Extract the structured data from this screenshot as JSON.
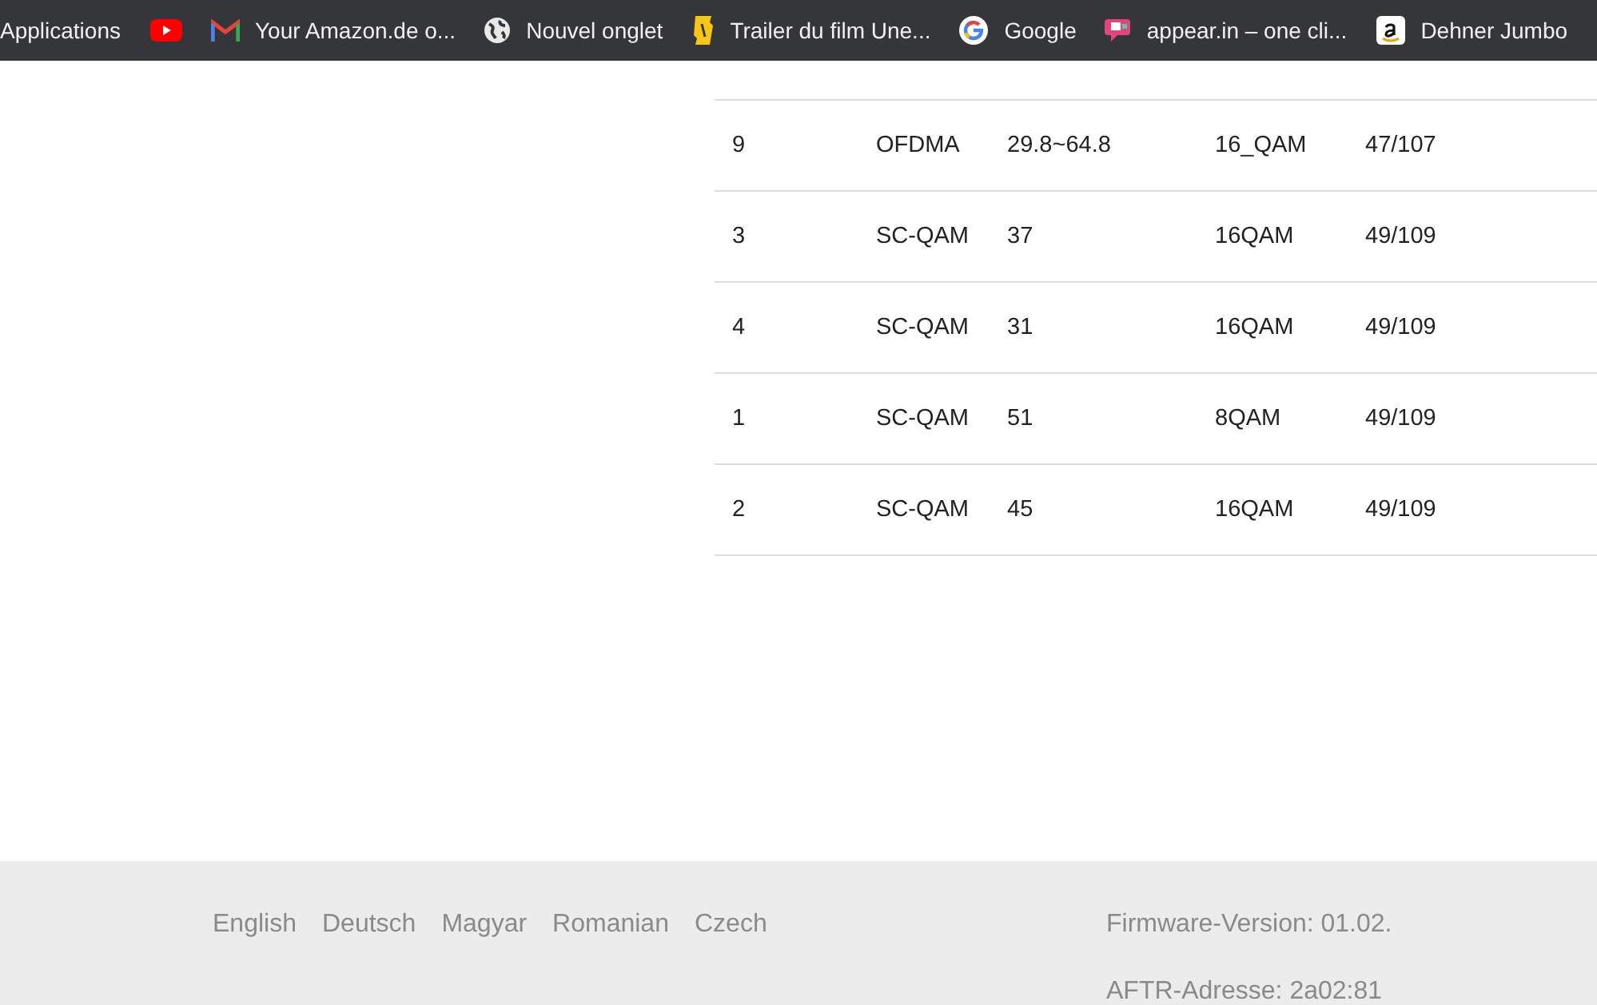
{
  "bookmarks": [
    {
      "kind": "text",
      "label": "Applications"
    },
    {
      "kind": "youtube"
    },
    {
      "kind": "gmail",
      "label": "Your Amazon.de o..."
    },
    {
      "kind": "globe",
      "label": "Nouvel onglet"
    },
    {
      "kind": "ticket",
      "label": "Trailer du film Une..."
    },
    {
      "kind": "google",
      "label": "Google"
    },
    {
      "kind": "chat",
      "label": "appear.in – one cli..."
    },
    {
      "kind": "amazon",
      "label": "Dehner Jumbo"
    }
  ],
  "table": {
    "rows": [
      [
        "9",
        "OFDMA",
        "29.8~64.8",
        "16_QAM",
        "47/107"
      ],
      [
        "3",
        "SC-QAM",
        "37",
        "16QAM",
        "49/109"
      ],
      [
        "4",
        "SC-QAM",
        "31",
        "16QAM",
        "49/109"
      ],
      [
        "1",
        "SC-QAM",
        "51",
        "8QAM",
        "49/109"
      ],
      [
        "2",
        "SC-QAM",
        "45",
        "16QAM",
        "49/109"
      ]
    ]
  },
  "footer": {
    "languages": [
      "English",
      "Deutsch",
      "Magyar",
      "Romanian",
      "Czech"
    ],
    "info": [
      "Firmware-Version: 01.02.",
      "AFTR-Adresse: 2a02:81"
    ]
  }
}
